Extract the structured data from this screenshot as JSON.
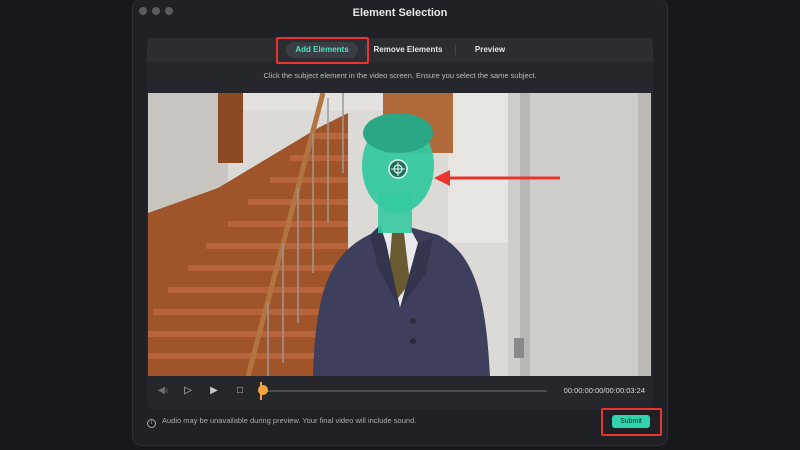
{
  "window": {
    "title": "Element Selection"
  },
  "tabs": [
    {
      "label": "Add Elements",
      "active": true
    },
    {
      "label": "Remove Elements",
      "active": false
    },
    {
      "label": "Preview",
      "active": false
    }
  ],
  "instruction": "Click the subject element in the video screen. Ensure you select the same subject.",
  "player": {
    "timecode": "00:00:00:00/00:00:03:24",
    "progress": 0.0
  },
  "footer": {
    "note": "Audio may be unavailable during preview. Your final video will include sound.",
    "submit_label": "Submit"
  },
  "colors": {
    "accent": "#32d4ae",
    "highlight": "#e8362f",
    "playhead": "#f5a43a",
    "selection_overlay": "#35c9a0"
  },
  "icons": {
    "info": "info-icon",
    "target": "crosshair-target-icon",
    "annotation_arrow": "red-arrow-icon"
  }
}
